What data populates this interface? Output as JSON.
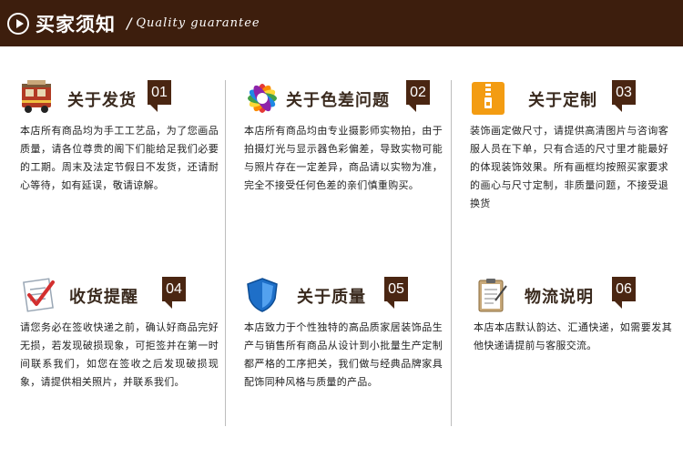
{
  "header": {
    "title": "买家须知",
    "separator": "/",
    "subtitle": "Quality guarantee"
  },
  "sections": [
    {
      "title": "关于发货",
      "number": "01",
      "icon": "delivery-truck-icon",
      "text": "本店所有商品均为手工工艺品，为了您画品质量，请各位尊贵的阁下们能给足我们必要的工期。周末及法定节假日不发货，还请耐心等待，如有延误，敬请谅解。"
    },
    {
      "title": "关于色差问题",
      "number": "02",
      "icon": "color-wheel-icon",
      "text": "本店所有商品均由专业摄影师实物拍，由于拍摄灯光与显示器色彩偏差，导致实物可能与照片存在一定差异，商品请以实物为准，完全不接受任何色差的亲们慎重购买。"
    },
    {
      "title": "关于定制",
      "number": "03",
      "icon": "zip-file-icon",
      "text": "装饰画定做尺寸，请提供高清图片与咨询客服人员在下单，只有合适的尺寸里才能最好的体现装饰效果。所有画框均按照买家要求的画心与尺寸定制，非质量问题，不接受退换货"
    },
    {
      "title": "收货提醒",
      "number": "04",
      "icon": "checklist-icon",
      "text": "请您务必在签收快递之前，确认好商品完好无损，若发现破损现象，可拒签并在第一时间联系我们，如您在签收之后发现破损现象，请提供相关照片，并联系我们。"
    },
    {
      "title": "关于质量",
      "number": "05",
      "icon": "shield-icon",
      "text": "本店致力于个性独特的高品质家居装饰品生产与销售所有商品从设计到小批量生产定制都严格的工序把关，我们做与经典品牌家具配饰同种风格与质量的产品。"
    },
    {
      "title": "物流说明",
      "number": "06",
      "icon": "clipboard-icon",
      "text": "本店本店默认韵达、汇通快递，如需要发其他快递请提前与客服交流。"
    }
  ],
  "colors": {
    "header_bg": "#3d1e0d",
    "number_bg": "#4a2612",
    "divider": "#bdbdbd"
  }
}
